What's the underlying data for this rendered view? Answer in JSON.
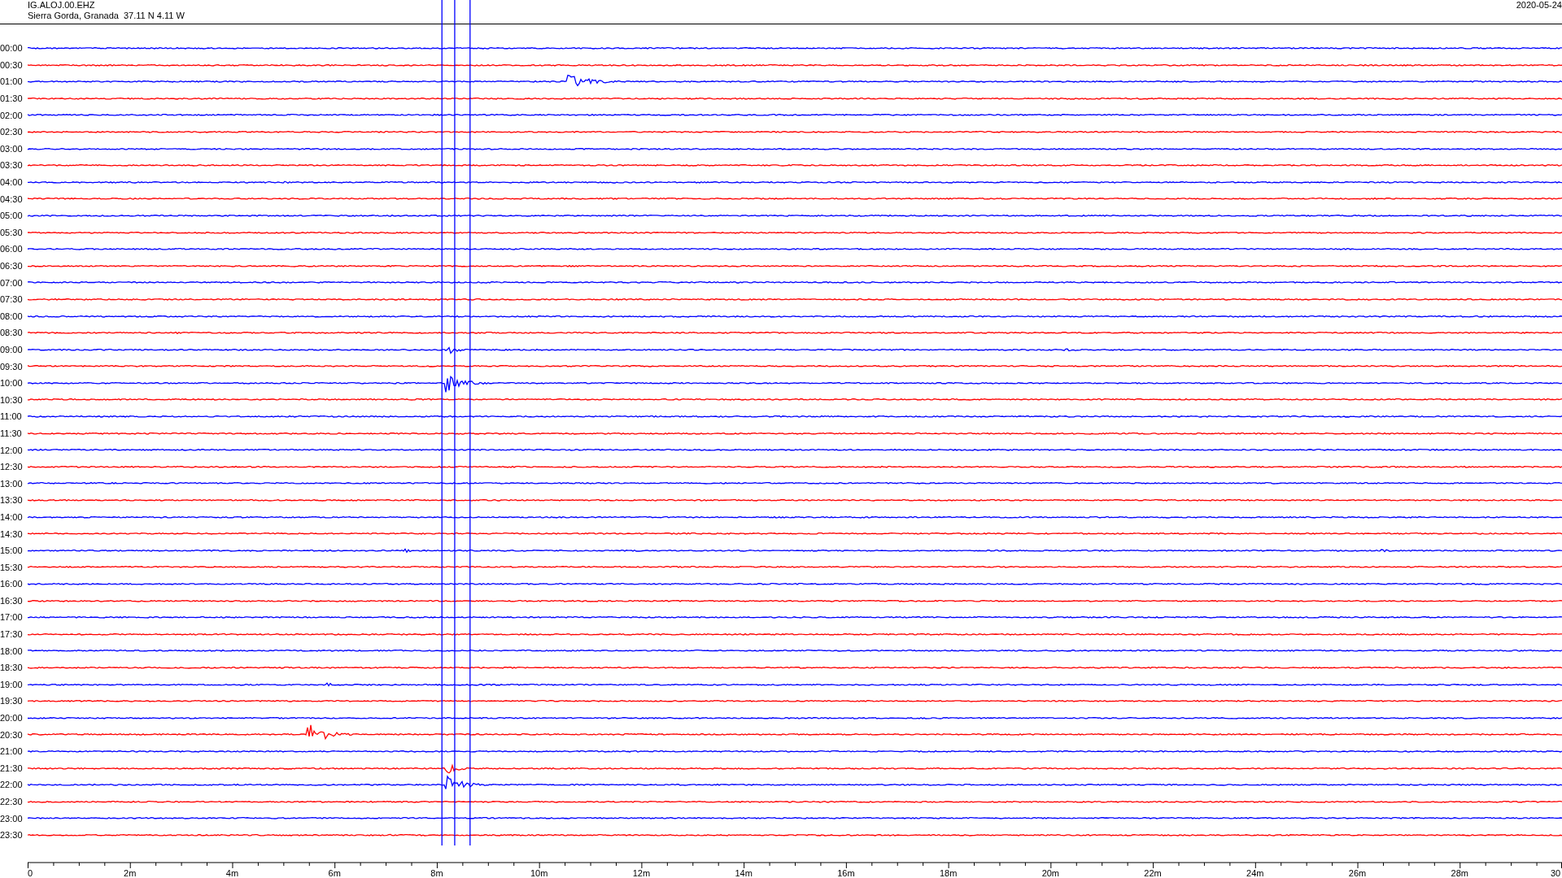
{
  "header": {
    "station": "IG.ALOJ.00.EHZ",
    "location": "Sierra Gorda, Granada  37.11 N 4.11 W",
    "date": "2020-05-24"
  },
  "rows": [
    {
      "label": "00:00",
      "color": "#0000ff"
    },
    {
      "label": "00:30",
      "color": "#ff0000"
    },
    {
      "label": "01:00",
      "color": "#0000ff"
    },
    {
      "label": "01:30",
      "color": "#ff0000"
    },
    {
      "label": "02:00",
      "color": "#0000ff"
    },
    {
      "label": "02:30",
      "color": "#ff0000"
    },
    {
      "label": "03:00",
      "color": "#0000ff"
    },
    {
      "label": "03:30",
      "color": "#ff0000"
    },
    {
      "label": "04:00",
      "color": "#0000ff"
    },
    {
      "label": "04:30",
      "color": "#ff0000"
    },
    {
      "label": "05:00",
      "color": "#0000ff"
    },
    {
      "label": "05:30",
      "color": "#ff0000"
    },
    {
      "label": "06:00",
      "color": "#0000ff"
    },
    {
      "label": "06:30",
      "color": "#ff0000"
    },
    {
      "label": "07:00",
      "color": "#0000ff"
    },
    {
      "label": "07:30",
      "color": "#ff0000"
    },
    {
      "label": "08:00",
      "color": "#0000ff"
    },
    {
      "label": "08:30",
      "color": "#ff0000"
    },
    {
      "label": "09:00",
      "color": "#0000ff"
    },
    {
      "label": "09:30",
      "color": "#ff0000"
    },
    {
      "label": "10:00",
      "color": "#0000ff"
    },
    {
      "label": "10:30",
      "color": "#ff0000"
    },
    {
      "label": "11:00",
      "color": "#0000ff"
    },
    {
      "label": "11:30",
      "color": "#ff0000"
    },
    {
      "label": "12:00",
      "color": "#0000ff"
    },
    {
      "label": "12:30",
      "color": "#ff0000"
    },
    {
      "label": "13:00",
      "color": "#0000ff"
    },
    {
      "label": "13:30",
      "color": "#ff0000"
    },
    {
      "label": "14:00",
      "color": "#0000ff"
    },
    {
      "label": "14:30",
      "color": "#ff0000"
    },
    {
      "label": "15:00",
      "color": "#0000ff"
    },
    {
      "label": "15:30",
      "color": "#ff0000"
    },
    {
      "label": "16:00",
      "color": "#0000ff"
    },
    {
      "label": "16:30",
      "color": "#ff0000"
    },
    {
      "label": "17:00",
      "color": "#0000ff"
    },
    {
      "label": "17:30",
      "color": "#ff0000"
    },
    {
      "label": "18:00",
      "color": "#0000ff"
    },
    {
      "label": "18:30",
      "color": "#ff0000"
    },
    {
      "label": "19:00",
      "color": "#0000ff"
    },
    {
      "label": "19:30",
      "color": "#ff0000"
    },
    {
      "label": "20:00",
      "color": "#0000ff"
    },
    {
      "label": "20:30",
      "color": "#ff0000"
    },
    {
      "label": "21:00",
      "color": "#0000ff"
    },
    {
      "label": "21:30",
      "color": "#ff0000"
    },
    {
      "label": "22:00",
      "color": "#0000ff"
    },
    {
      "label": "22:30",
      "color": "#ff0000"
    },
    {
      "label": "23:00",
      "color": "#0000ff"
    },
    {
      "label": "23:30",
      "color": "#ff0000"
    }
  ],
  "axis": {
    "ticks": [
      "0",
      "2m",
      "4m",
      "6m",
      "8m",
      "10m",
      "12m",
      "14m",
      "16m",
      "18m",
      "20m",
      "22m",
      "24m",
      "26m",
      "28m",
      "30"
    ]
  }
}
